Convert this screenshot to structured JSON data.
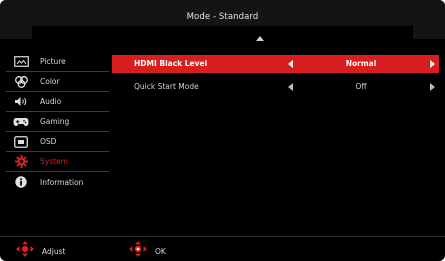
{
  "header": {
    "title": "Mode - Standard"
  },
  "sidebar": {
    "items": [
      {
        "label": "Picture",
        "icon": "picture-icon",
        "active": false
      },
      {
        "label": "Color",
        "icon": "color-icon",
        "active": false
      },
      {
        "label": "Audio",
        "icon": "audio-icon",
        "active": false
      },
      {
        "label": "Gaming",
        "icon": "gaming-icon",
        "active": false
      },
      {
        "label": "OSD",
        "icon": "osd-icon",
        "active": false
      },
      {
        "label": "System",
        "icon": "system-icon",
        "active": true
      },
      {
        "label": "Information",
        "icon": "information-icon",
        "active": false
      }
    ]
  },
  "settings": {
    "rows": [
      {
        "label": "HDMI Black Level",
        "value": "Normal",
        "highlighted": true
      },
      {
        "label": "Quick Start Mode",
        "value": "Off",
        "highlighted": false
      }
    ]
  },
  "footer": {
    "adjust_label": "Adjust",
    "ok_label": "OK"
  },
  "colors": {
    "accent": "#d81e1e",
    "background": "#000000",
    "header": "#141414",
    "text": "#d8d8d8"
  }
}
